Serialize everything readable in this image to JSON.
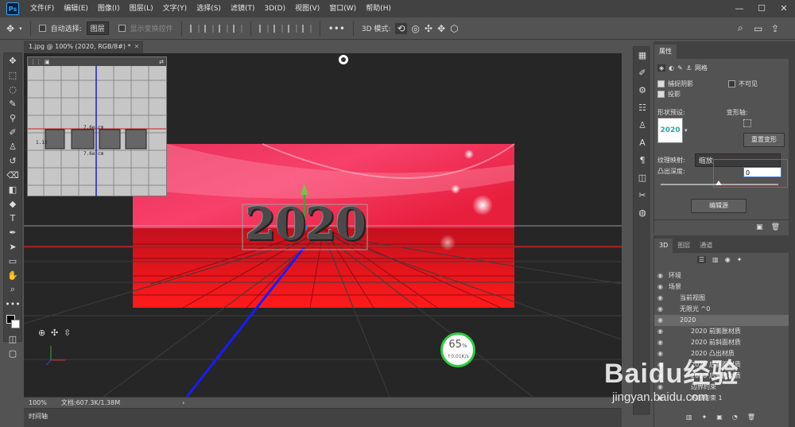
{
  "menubar": {
    "logo": "Ps",
    "items": [
      "文件(F)",
      "编辑(E)",
      "图像(I)",
      "图层(L)",
      "文字(Y)",
      "选择(S)",
      "滤镜(T)",
      "3D(D)",
      "视图(V)",
      "窗口(W)",
      "帮助(H)"
    ],
    "min": "—",
    "max": "☐",
    "close": "✕"
  },
  "options": {
    "auto_select_label": "自动选择:",
    "auto_select_value": "图层",
    "show_transform": "显示变换控件",
    "mode_label": "3D 模式:"
  },
  "doc_tab": {
    "title": "1.jpg @ 100% (2020, RGB/8#) *"
  },
  "status": {
    "zoom": "100%",
    "doc": "文档:607.3K/1.38M"
  },
  "timeline": {
    "label": "时间轴"
  },
  "canvas": {
    "text": "2020",
    "sec_view": {
      "measure_top": "7.6e cm",
      "measure_bot": "7.6e cm",
      "left_num": "1.13"
    },
    "net": {
      "percent": "65",
      "unit": "%",
      "speed": "↑0.01K/s"
    }
  },
  "properties": {
    "tab": "属性",
    "sub_tabs": [
      "网格"
    ],
    "catch_shadow": "捕捉阴影",
    "cast_shadow": "投影",
    "invisible": "不可见",
    "shape_preset_label": "形状预设:",
    "preset_text": "2020",
    "deform_axis_label": "变形轴:",
    "reset_deform": "重置变形",
    "texture_label": "纹理映射:",
    "texture_value": "缩放",
    "extrude_label": "凸出深度:",
    "extrude_value": "0",
    "edit_source": "编辑源"
  },
  "layers3d": {
    "tabs": [
      "3D",
      "图层",
      "通道"
    ],
    "rows": [
      {
        "name": "环境",
        "indent": 0
      },
      {
        "name": "场景",
        "indent": 0
      },
      {
        "name": "当前视图",
        "indent": 1
      },
      {
        "name": "无限光 ^0",
        "indent": 1
      },
      {
        "name": "2020",
        "indent": 1
      },
      {
        "name": "2020 前膨胀材质",
        "indent": 2
      },
      {
        "name": "2020 前斜面材质",
        "indent": 2
      },
      {
        "name": "2020 凸出材质",
        "indent": 2
      },
      {
        "name": "2020 后斜面材质",
        "indent": 2
      },
      {
        "name": "2020 后膨胀材质",
        "indent": 2
      },
      {
        "name": "边界约束",
        "indent": 2
      },
      {
        "name": "内部约束 1",
        "indent": 2
      }
    ]
  },
  "watermark": {
    "brand": "Baidu经验",
    "url": "jingyan.baidu.com"
  },
  "colors": {
    "accent": "#ff2a55",
    "ring": "#2ecc40"
  }
}
